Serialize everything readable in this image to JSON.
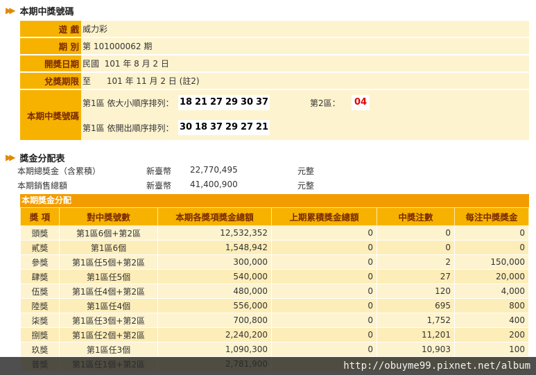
{
  "section1": {
    "title": "本期中獎號碼"
  },
  "info": {
    "game_label": "遊 戲",
    "game_value": "威力彩",
    "period_label": "期 別",
    "period_value": "第 101000062 期",
    "draw_date_label": "開獎日期",
    "draw_date_value": "民國  101 年 8 月 2 日",
    "redeem_label": "兌獎期限",
    "redeem_value": "至      101 年 11 月 2 日 (註2)",
    "winning_label": "本期中獎號碼",
    "sorted_label": "第1區 依大小順序排列：",
    "sorted_numbers": [
      "18",
      "21",
      "27",
      "29",
      "30",
      "37"
    ],
    "zone2_label": "第2區：",
    "zone2_number": "04",
    "drawn_label": "第1區 依開出順序排列：",
    "drawn_numbers": [
      "30",
      "18",
      "37",
      "29",
      "27",
      "21"
    ]
  },
  "section2": {
    "title": "獎金分配表"
  },
  "summary": {
    "total_prize_label": "本期總獎金（含累積）",
    "total_prize_currency": "新臺幣",
    "total_prize_value": "22,770,495",
    "total_prize_unit": "元整",
    "sales_label": "本期銷售總額",
    "sales_currency": "新臺幣",
    "sales_value": "41,400,900",
    "sales_unit": "元整"
  },
  "prize_table": {
    "caption": "本期獎金分配",
    "headers": [
      "獎 項",
      "對中獎號數",
      "本期各獎項獎金總額",
      "上期累積獎金總額",
      "中獎注數",
      "每注中獎獎金"
    ],
    "rows": [
      [
        "頭獎",
        "第1區6個+第2區",
        "12,532,352",
        "0",
        "0",
        "0"
      ],
      [
        "貳獎",
        "第1區6個",
        "1,548,942",
        "0",
        "0",
        "0"
      ],
      [
        "參獎",
        "第1區任5個+第2區",
        "300,000",
        "0",
        "2",
        "150,000"
      ],
      [
        "肆獎",
        "第1區任5個",
        "540,000",
        "0",
        "27",
        "20,000"
      ],
      [
        "伍獎",
        "第1區任4個+第2區",
        "480,000",
        "0",
        "120",
        "4,000"
      ],
      [
        "陸獎",
        "第1區任4個",
        "556,000",
        "0",
        "695",
        "800"
      ],
      [
        "柒獎",
        "第1區任3個+第2區",
        "700,800",
        "0",
        "1,752",
        "400"
      ],
      [
        "捌獎",
        "第1區任2個+第2區",
        "2,240,200",
        "0",
        "11,201",
        "200"
      ],
      [
        "玖獎",
        "第1區任3個",
        "1,090,300",
        "0",
        "10,903",
        "100"
      ],
      [
        "普獎",
        "第1區任1個+第2區",
        "2,781,900",
        "",
        "",
        ""
      ]
    ]
  },
  "watermark": {
    "text": "http://obuyme99.pixnet.net/album"
  },
  "colors": {
    "label_bg": "#f7b200",
    "value_bg": "#fdf3cf",
    "caption_bg": "#f39c00",
    "accent_red": "#e00000"
  }
}
